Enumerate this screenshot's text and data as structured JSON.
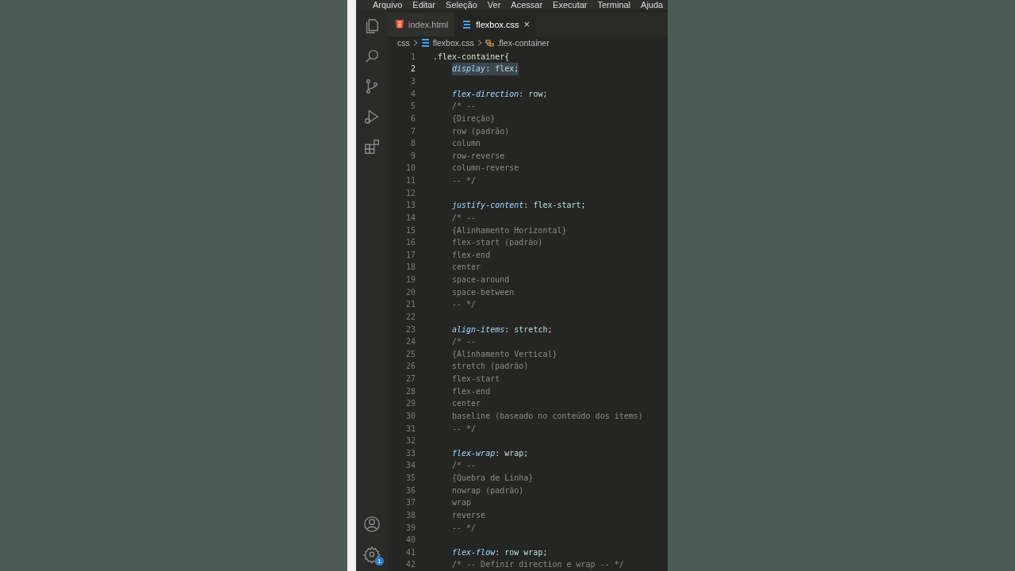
{
  "menu": [
    "Arquivo",
    "Editar",
    "Seleção",
    "Ver",
    "Acessar",
    "Executar",
    "Terminal",
    "Ajuda"
  ],
  "tabs": [
    {
      "label": "index.html",
      "kind": "html",
      "selected": false
    },
    {
      "label": "flexbox.css",
      "kind": "css",
      "selected": true,
      "close": "×"
    }
  ],
  "breadcrumb": [
    {
      "label": "css",
      "kind": "folder"
    },
    {
      "label": "flexbox.css",
      "kind": "css"
    },
    {
      "label": ".flex-container",
      "kind": "symbol"
    }
  ],
  "activity_bar": {
    "settings_badge": "1"
  },
  "editor": {
    "lines": [
      {
        "number": "1",
        "kind": "selector",
        "text": ".flex-container{",
        "selected": false,
        "children": [
          {
            "number": "2",
            "kind": "declaration",
            "tokens": [
              {
                "kind": "property",
                "text": "display"
              },
              {
                "kind": "punct",
                "text": ":"
              },
              {
                "kind": "value",
                "text": "flex"
              },
              {
                "kind": "punct",
                "text": ";"
              }
            ],
            "selected": true
          },
          {
            "number": "3",
            "kind": "blank",
            "selected": false
          },
          {
            "number": "4",
            "kind": "declaration",
            "tokens": [
              {
                "kind": "property",
                "text": "flex-direction"
              },
              {
                "kind": "punct",
                "text": ":"
              },
              {
                "kind": "value",
                "text": "row"
              },
              {
                "kind": "punct",
                "text": ";"
              }
            ],
            "selected": false
          },
          {
            "number": "5",
            "kind": "comment",
            "text": "/* --",
            "selected": false
          },
          {
            "number": "6",
            "kind": "comment",
            "text": "{Direção}",
            "selected": false
          },
          {
            "number": "7",
            "kind": "comment",
            "text": "row (padrão)",
            "selected": false
          },
          {
            "number": "8",
            "kind": "comment",
            "text": "column",
            "selected": false
          },
          {
            "number": "9",
            "kind": "comment",
            "text": "row-reverse",
            "selected": false
          },
          {
            "number": "10",
            "kind": "comment",
            "text": "column-reverse",
            "selected": false
          },
          {
            "number": "11",
            "kind": "comment",
            "text": "-- */",
            "selected": false
          },
          {
            "number": "12",
            "kind": "blank",
            "selected": false
          },
          {
            "number": "13",
            "kind": "declaration",
            "tokens": [
              {
                "kind": "property",
                "text": "justify-content"
              },
              {
                "kind": "punct",
                "text": ":"
              },
              {
                "kind": "value",
                "text": "flex-start"
              },
              {
                "kind": "punct",
                "text": ";"
              }
            ],
            "selected": false
          },
          {
            "number": "14",
            "kind": "comment",
            "text": "/* --",
            "selected": false
          },
          {
            "number": "15",
            "kind": "comment",
            "text": "{Alinhamento Horizontal}",
            "selected": false
          },
          {
            "number": "16",
            "kind": "comment",
            "text": "flex-start (padrão)",
            "selected": false
          },
          {
            "number": "17",
            "kind": "comment",
            "text": "flex-end",
            "selected": false
          },
          {
            "number": "18",
            "kind": "comment",
            "text": "center",
            "selected": false
          },
          {
            "number": "19",
            "kind": "comment",
            "text": "space-around",
            "selected": false
          },
          {
            "number": "20",
            "kind": "comment",
            "text": "space-between",
            "selected": false
          },
          {
            "number": "21",
            "kind": "comment",
            "text": "-- */",
            "selected": false
          },
          {
            "number": "22",
            "kind": "blank",
            "selected": false
          },
          {
            "number": "23",
            "kind": "declaration",
            "tokens": [
              {
                "kind": "property",
                "text": "align-items"
              },
              {
                "kind": "punct",
                "text": ":"
              },
              {
                "kind": "value",
                "text": "stretch"
              },
              {
                "kind": "punct",
                "text": ";"
              }
            ],
            "selected": false
          },
          {
            "number": "24",
            "kind": "comment",
            "text": "/* --",
            "selected": false
          },
          {
            "number": "25",
            "kind": "comment",
            "text": "{Alinhamento Vertical}",
            "selected": false
          },
          {
            "number": "26",
            "kind": "comment",
            "text": "stretch (padrão)",
            "selected": false
          },
          {
            "number": "27",
            "kind": "comment",
            "text": "flex-start",
            "selected": false
          },
          {
            "number": "28",
            "kind": "comment",
            "text": "flex-end",
            "selected": false
          },
          {
            "number": "29",
            "kind": "comment",
            "text": "center",
            "selected": false
          },
          {
            "number": "30",
            "kind": "comment",
            "text": "baseline (baseado no conteúdo dos items)",
            "selected": false
          },
          {
            "number": "31",
            "kind": "comment",
            "text": "-- */",
            "selected": false
          },
          {
            "number": "32",
            "kind": "blank",
            "selected": false
          },
          {
            "number": "33",
            "kind": "declaration",
            "tokens": [
              {
                "kind": "property",
                "text": "flex-wrap"
              },
              {
                "kind": "punct",
                "text": ":"
              },
              {
                "kind": "value",
                "text": "wrap"
              },
              {
                "kind": "punct",
                "text": ";"
              }
            ],
            "selected": false
          },
          {
            "number": "34",
            "kind": "comment",
            "text": "/* --",
            "selected": false
          },
          {
            "number": "35",
            "kind": "comment",
            "text": "{Quebra de Linha}",
            "selected": false
          },
          {
            "number": "36",
            "kind": "comment",
            "text": "nowrap (padrão)",
            "selected": false
          },
          {
            "number": "37",
            "kind": "comment",
            "text": "wrap",
            "selected": false
          },
          {
            "number": "38",
            "kind": "comment",
            "text": "reverse",
            "selected": false
          },
          {
            "number": "39",
            "kind": "comment",
            "text": "-- */",
            "selected": false
          },
          {
            "number": "40",
            "kind": "blank",
            "selected": false
          },
          {
            "number": "41",
            "kind": "declaration",
            "tokens": [
              {
                "kind": "property",
                "text": "flex-flow"
              },
              {
                "kind": "punct",
                "text": ":"
              },
              {
                "kind": "value",
                "text": "row wrap"
              },
              {
                "kind": "punct",
                "text": ";"
              }
            ],
            "selected": false
          },
          {
            "number": "42",
            "kind": "comment",
            "text": "/* -- Definir direction e wrap -- */",
            "selected": false
          }
        ]
      }
    ]
  }
}
